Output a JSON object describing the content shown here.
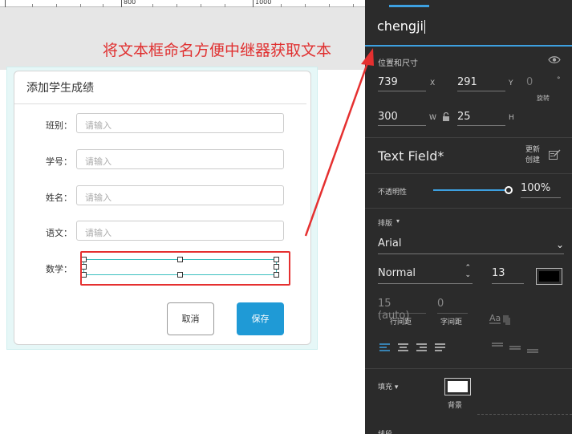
{
  "ruler": {
    "labels": [
      "800",
      "1000"
    ]
  },
  "annotation": {
    "text": "将文本框命名方便中继器获取文本",
    "color": "#e03030"
  },
  "dialog": {
    "title": "添加学生成绩",
    "fields": [
      {
        "label": "班别：",
        "placeholder": "请输入"
      },
      {
        "label": "学号：",
        "placeholder": "请输入"
      },
      {
        "label": "姓名：",
        "placeholder": "请输入"
      },
      {
        "label": "语文：",
        "placeholder": "请输入"
      },
      {
        "label": "数学：",
        "placeholder": ""
      }
    ],
    "cancel_label": "取消",
    "save_label": "保存",
    "save_color": "#1f9ad6"
  },
  "panel": {
    "name_value": "chengji",
    "section_position": "位置和尺寸",
    "x": "739",
    "y": "291",
    "rotation": "0",
    "rotation_unit": "°",
    "rotation_label": "旋转",
    "w": "300",
    "h": "25",
    "axis": {
      "x": "X",
      "y": "Y",
      "w": "W",
      "h": "H"
    },
    "widget_type": "Text Field*",
    "reset_label": "更新创建",
    "opacity_label": "不透明性",
    "opacity_value": "100%",
    "opacity_fraction": 1.0,
    "typography_label": "排版",
    "font_family": "Arial",
    "font_weight": "Normal",
    "font_size": "13",
    "text_color": "#000000",
    "line_height_value": "15 (auto)",
    "letter_spacing_value": "0",
    "line_height_label": "行间距",
    "letter_spacing_label": "字间距",
    "fill_label": "填充",
    "fill_color": "#ffffff",
    "fill_bg_label": "背景",
    "border_label": "线段",
    "accent_color": "#3da0e0",
    "icons": [
      "eye-icon",
      "lock-icon",
      "reset-style-icon",
      "chevron-down-icon",
      "stepper-icon",
      "text-style-icon",
      "align-left-icon",
      "align-center-icon",
      "align-right-icon",
      "align-justify-icon",
      "valign-top-icon",
      "valign-middle-icon",
      "valign-bottom-icon"
    ]
  }
}
